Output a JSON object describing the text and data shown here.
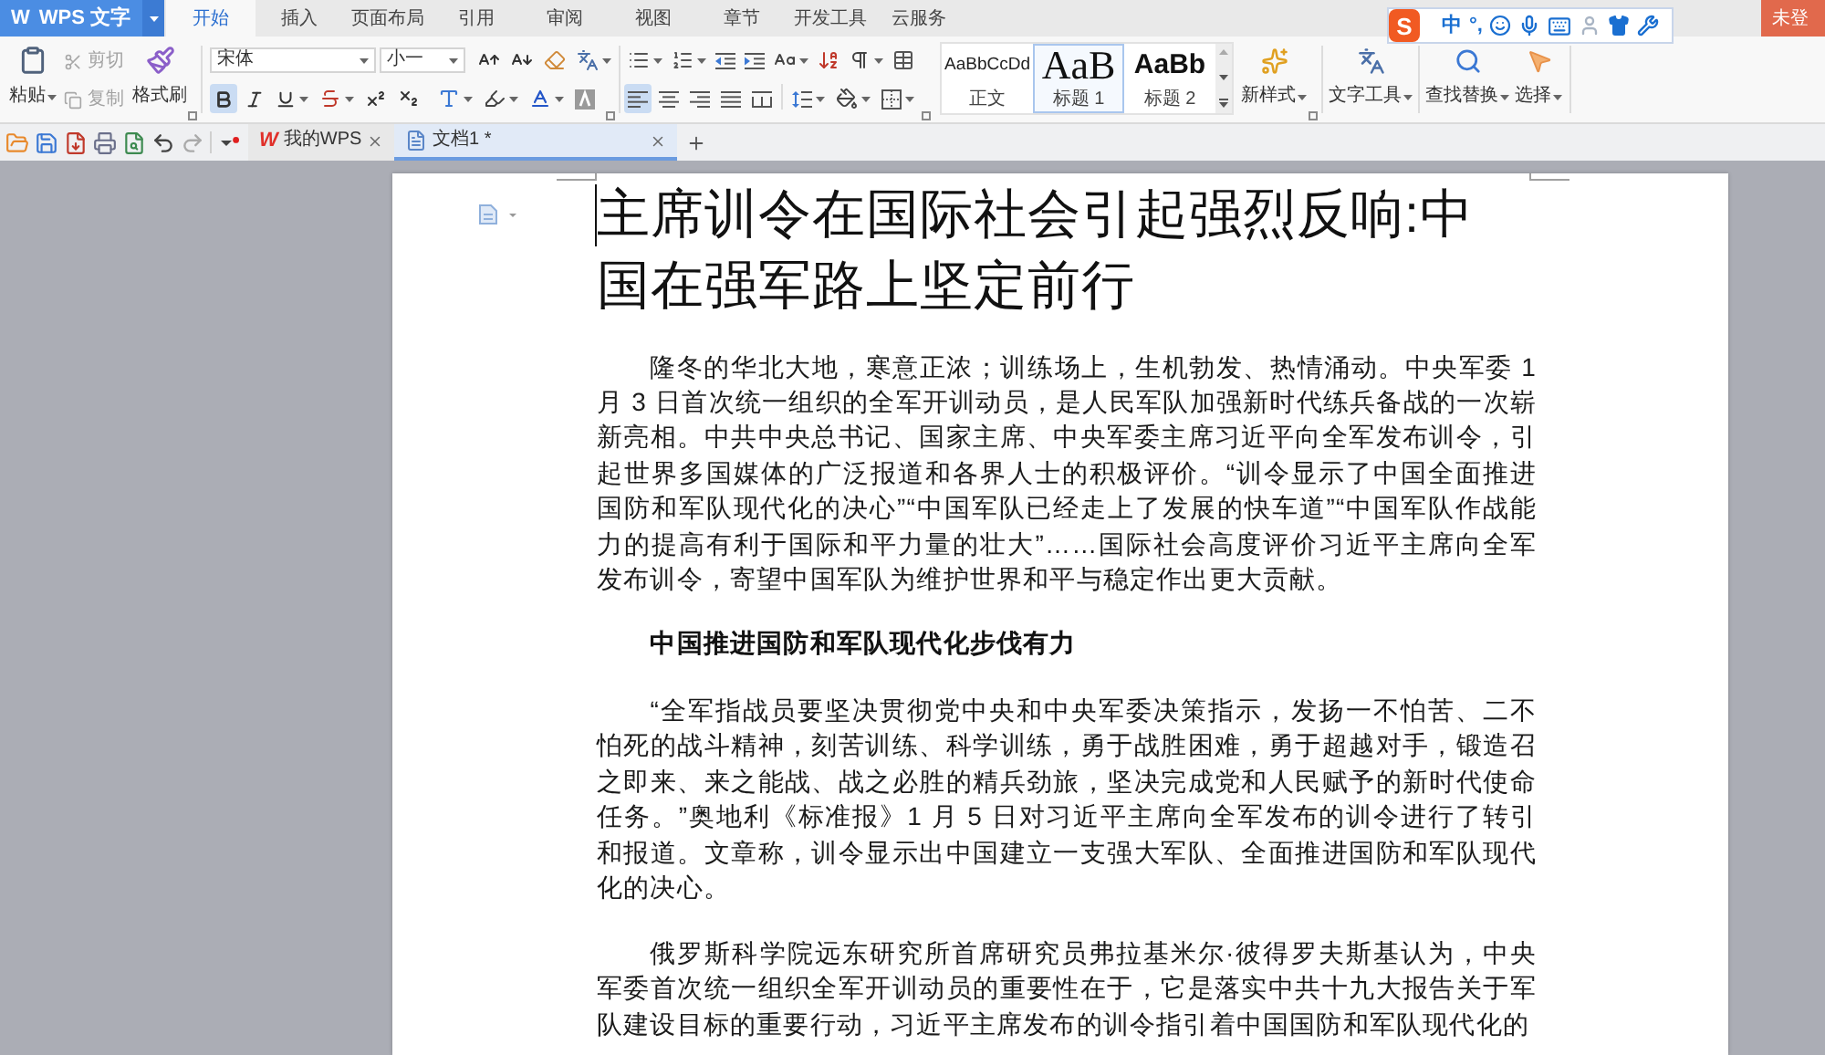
{
  "app_button": {
    "logo": "W",
    "label": "WPS 文字"
  },
  "ribbon_tabs": [
    {
      "label": "开始",
      "selected": true
    },
    {
      "label": "插入",
      "selected": false
    },
    {
      "label": "页面布局",
      "selected": false
    },
    {
      "label": "引用",
      "selected": false
    },
    {
      "label": "审阅",
      "selected": false
    },
    {
      "label": "视图",
      "selected": false
    },
    {
      "label": "章节",
      "selected": false
    },
    {
      "label": "开发工具",
      "selected": false
    },
    {
      "label": "云服务",
      "selected": false
    }
  ],
  "account_button": {
    "label": "未登"
  },
  "ime_bar": {
    "logo": "S",
    "mode": "中",
    "punctuation": "°,"
  },
  "clipboard": {
    "paste": {
      "label": "粘贴"
    },
    "items": [
      {
        "kind": "cut",
        "label": "剪切",
        "disabled": true
      },
      {
        "kind": "copy",
        "label": "复制",
        "disabled": true
      }
    ],
    "format_painter": {
      "label": "格式刷"
    }
  },
  "font": {
    "name": "宋体",
    "size": "小一",
    "formats": [
      {
        "kind": "bold",
        "selected": true
      },
      {
        "kind": "italic",
        "selected": false
      },
      {
        "kind": "underline",
        "selected": false
      },
      {
        "kind": "strikethrough",
        "selected": false
      },
      {
        "kind": "superscript",
        "selected": false
      },
      {
        "kind": "subscript",
        "selected": false
      }
    ]
  },
  "paragraph": {
    "alignment": [
      {
        "kind": "left",
        "selected": true
      },
      {
        "kind": "center",
        "selected": false
      },
      {
        "kind": "right",
        "selected": false
      },
      {
        "kind": "justify",
        "selected": false
      },
      {
        "kind": "distributed",
        "selected": false
      }
    ]
  },
  "styles": [
    {
      "kind": "body",
      "sample": "AaBbCcDd",
      "name": "正文",
      "selected": false
    },
    {
      "kind": "heading1",
      "sample": "AaB",
      "name": "标题 1",
      "selected": true
    },
    {
      "kind": "heading2",
      "sample": "AaBb",
      "name": "标题 2",
      "selected": false
    }
  ],
  "tools": [
    {
      "kind": "new_style",
      "label": "新样式"
    },
    {
      "kind": "text_tools",
      "label": "文字工具"
    },
    {
      "kind": "find_replace",
      "label": "查找替换"
    },
    {
      "kind": "select",
      "label": "选择"
    }
  ],
  "doc_tabs": [
    {
      "kind": "home",
      "logo": "W",
      "label": "我的WPS",
      "selected": false
    },
    {
      "kind": "document",
      "label": "文档1 *",
      "selected": true
    }
  ],
  "document": {
    "title": "主席训令在国际社会引起强烈反响:中国在强军路上坚定前行",
    "paragraphs": [
      {
        "kind": "body",
        "text": "隆冬的华北大地，寒意正浓；训练场上，生机勃发、热情涌动。中央军委 1 月 3 日首次统一组织的全军开训动员，是人民军队加强新时代练兵备战的一次崭新亮相。中共中央总书记、国家主席、中央军委主席习近平向全军发布训令，引起世界多国媒体的广泛报道和各界人士的积极评价。“训令显示了中国全面推进国防和军队现代化的决心”“中国军队已经走上了发展的快车道”“中国军队作战能力的提高有利于国际和平力量的壮大”……国际社会高度评价习近平主席向全军发布训令，寄望中国军队为维护世界和平与稳定作出更大贡献。"
      },
      {
        "kind": "heading",
        "text": "中国推进国防和军队现代化步伐有力"
      },
      {
        "kind": "body",
        "text": "“全军指战员要坚决贯彻党中央和中央军委决策指示，发扬一不怕苦、二不怕死的战斗精神，刻苦训练、科学训练，勇于战胜困难，勇于超越对手，锻造召之即来、来之能战、战之必胜的精兵劲旅，坚决完成党和人民赋予的新时代使命任务。”奥地利《标准报》1 月 5 日对习近平主席向全军发布的训令进行了转引和报道。文章称，训令显示出中国建立一支强大军队、全面推进国防和军队现代化的决心。"
      },
      {
        "kind": "body",
        "text": "俄罗斯科学院远东研究所首席研究员弗拉基米尔·彼得罗夫斯基认为，中央军委首次统一组织全军开训动员的重要性在于，它是落实中共十九大报告关于军队建设目标的重要行动，习近平主席发布的训令指引着中国国防和军队现代化的"
      }
    ]
  }
}
